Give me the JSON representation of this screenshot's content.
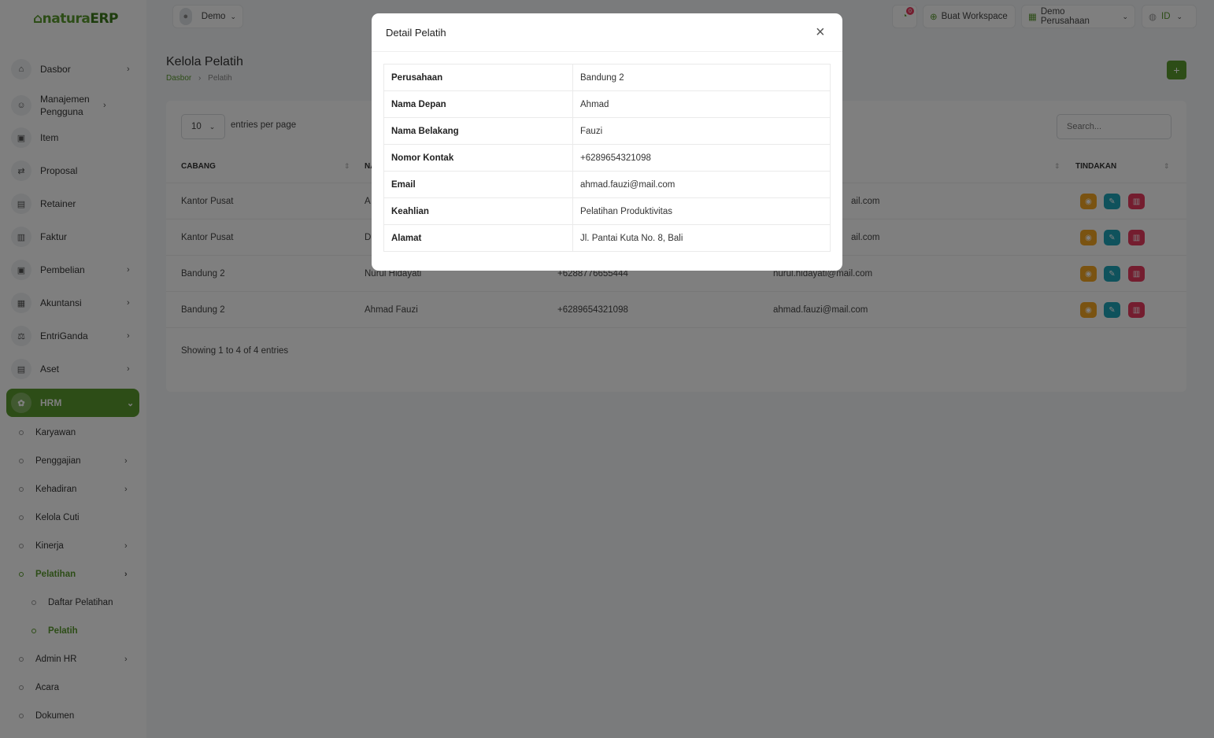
{
  "app": {
    "logo_main": "natura",
    "logo_erp": "ERP"
  },
  "sidebar": {
    "items": [
      {
        "label": "Dasbor",
        "icon": "home-icon"
      },
      {
        "label": "Manajemen Pengguna",
        "icon": "users-icon"
      },
      {
        "label": "Item",
        "icon": "cart-icon"
      },
      {
        "label": "Proposal",
        "icon": "proposal-icon"
      },
      {
        "label": "Retainer",
        "icon": "retainer-icon"
      },
      {
        "label": "Faktur",
        "icon": "invoice-icon"
      },
      {
        "label": "Pembelian",
        "icon": "purchase-icon"
      },
      {
        "label": "Akuntansi",
        "icon": "grid-icon"
      },
      {
        "label": "EntriGanda",
        "icon": "scale-icon"
      },
      {
        "label": "Aset",
        "icon": "asset-icon"
      },
      {
        "label": "HRM",
        "icon": "hrm-icon"
      }
    ],
    "hrm_sub": [
      "Karyawan",
      "Penggajian",
      "Kehadiran",
      "Kelola Cuti",
      "Kinerja",
      "Pelatihan",
      "Daftar Pelatihan",
      "Pelatih",
      "Admin HR",
      "Acara",
      "Dokumen"
    ]
  },
  "topbar": {
    "user": "Demo",
    "notif_count": "0",
    "create_workspace": "Buat Workspace",
    "company": "Demo Perusahaan",
    "language": "ID"
  },
  "page": {
    "title": "Kelola Pelatih",
    "breadcrumb_home": "Dasbor",
    "breadcrumb_sep": "›",
    "breadcrumb_current": "Pelatih",
    "add_label": "+"
  },
  "table": {
    "entries_value": "10",
    "entries_label": "entries per page",
    "search_placeholder": "Search...",
    "columns": {
      "branch": "CABANG",
      "name": "NA",
      "actions": "TINDAKAN"
    },
    "rows": [
      {
        "branch": "Kantor Pusat",
        "name": "A",
        "contact": "",
        "email": "ail.com"
      },
      {
        "branch": "Kantor Pusat",
        "name": "D",
        "contact": "",
        "email": "ail.com"
      },
      {
        "branch": "Bandung 2",
        "name": "Nurul Hidayati",
        "contact": "+6288776655444",
        "email": "nurul.hidayati@mail.com"
      },
      {
        "branch": "Bandung 2",
        "name": "Ahmad Fauzi",
        "contact": "+6289654321098",
        "email": "ahmad.fauzi@mail.com"
      }
    ],
    "showing": "Showing 1 to 4 of 4 entries"
  },
  "modal": {
    "title": "Detail Pelatih",
    "close": "×",
    "fields": [
      {
        "key": "Perusahaan",
        "value": "Bandung 2"
      },
      {
        "key": "Nama Depan",
        "value": "Ahmad"
      },
      {
        "key": "Nama Belakang",
        "value": "Fauzi"
      },
      {
        "key": "Nomor Kontak",
        "value": "+6289654321098"
      },
      {
        "key": "Email",
        "value": "ahmad.fauzi@mail.com"
      },
      {
        "key": "Keahlian",
        "value": "Pelatihan Produktivitas"
      },
      {
        "key": "Alamat",
        "value": "Jl. Pantai Kuta No. 8, Bali"
      }
    ]
  },
  "colors": {
    "accent": "#5a9a2e",
    "view": "#f5a623",
    "edit": "#1fa5b8",
    "delete": "#e83a5e"
  }
}
